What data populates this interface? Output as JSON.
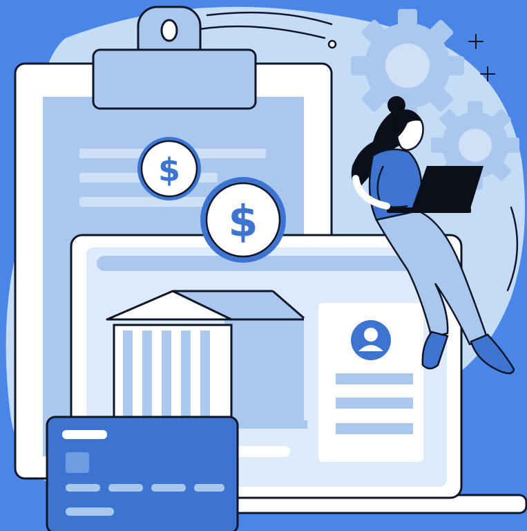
{
  "illustration": {
    "coin_symbols": [
      "$",
      "$"
    ],
    "icons": [
      "bank-icon",
      "user-avatar-icon",
      "gear-icon",
      "sparkle-icon",
      "credit-card-icon",
      "laptop-icon",
      "clipboard-icon"
    ]
  },
  "colors": {
    "background": "#4a86e8",
    "blob": "#c4dcf6",
    "primary_blue": "#3d74d0",
    "light_blue": "#aac8ee",
    "pale_blue": "#dceaf9",
    "outline": "#0d1526",
    "white": "#ffffff",
    "laptop": "#0a0f1a"
  }
}
